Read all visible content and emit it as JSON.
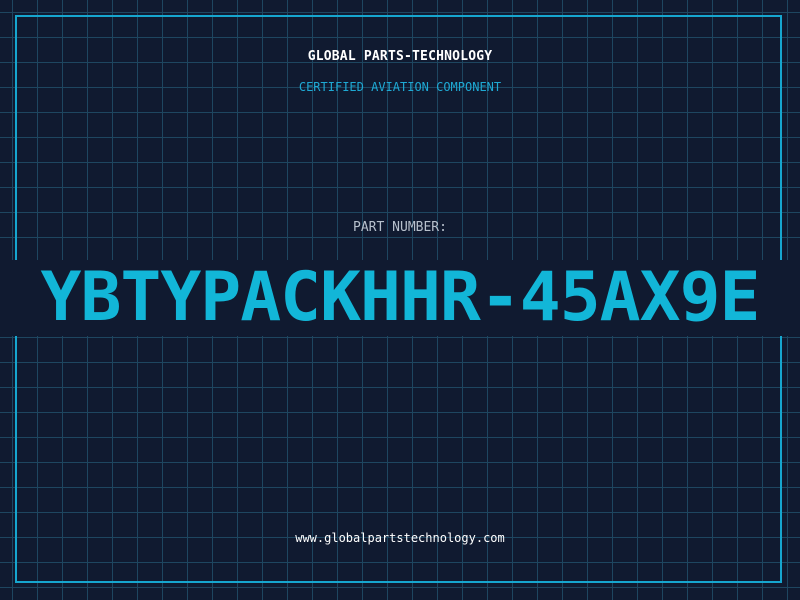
{
  "header": {
    "company": "GLOBAL PARTS-TECHNOLOGY",
    "tagline": "CERTIFIED AVIATION COMPONENT"
  },
  "part": {
    "label": "PART NUMBER:",
    "number": "YBTYPACKHHR-45AX9E"
  },
  "footer": {
    "website": "www.globalpartstechnology.com"
  },
  "colors": {
    "background": "#101a30",
    "grid": "#1e4660",
    "accent": "#16a6cf",
    "text": "#ffffff"
  }
}
